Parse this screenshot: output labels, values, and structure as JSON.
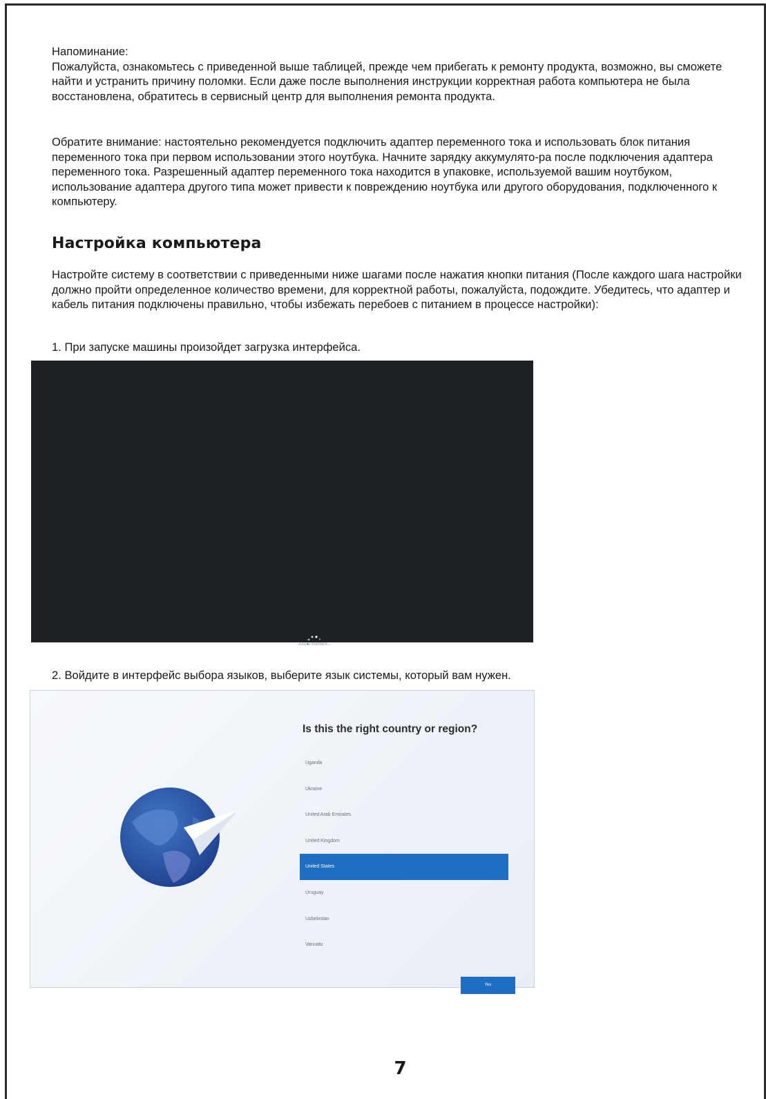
{
  "reminder": {
    "title": "Напоминание:",
    "body": "Пожалуйста, ознакомьтесь с  приведенной выше таблицей, прежде чем прибегать к ремонту продукта, возможно, вы сможете найти и устранить причину поломки. Если даже после  выполнения  инструкции корректная работа компьютера не была восстановлена,  обратитесь в сервисный центр для выполнения ремонта продукта."
  },
  "note": "Обратите внимание: настоятельно рекомендуется подключить адаптер переменного тока и использовать блок питания переменного тока при первом использовании этого ноутбука. Начните зарядку аккумулято-ра после подключения адаптера переменного тока. Разрешенный адаптер переменного тока находится в упаковке, используемой вашим ноутбуком, использование адаптера другого типа может привести к повреждению ноутбука или другого оборудования, подключенного к компьютеру.",
  "setup": {
    "heading": "Настройка компьютера",
    "intro": "Настройте систему в соответствии с приведенными ниже шагами после нажатия кнопки питания (После каждого шага настройки должно пройти определенное количество времени, для корректной работы, пожалуйста, подождите. Убедитесь, что адаптер и кабель питания подключены правильно, чтобы избежать перебоев с питанием в процессе настройки):",
    "step1": "1. При запуске машины произойдет загрузка интерфейса.",
    "step2": "2. Войдите в интерфейс выбора языков, выберите язык системы, который вам нужен."
  },
  "loading_screen": {
    "text": "Just a moment...",
    "icon": "spinner-icon"
  },
  "region_screen": {
    "title": "Is this the right country or region?",
    "regions": [
      {
        "label": "Uganda",
        "selected": false
      },
      {
        "label": "Ukraine",
        "selected": false
      },
      {
        "label": "United Arab Emirates",
        "selected": false
      },
      {
        "label": "United Kingdom",
        "selected": false
      },
      {
        "label": "United States",
        "selected": true
      },
      {
        "label": "Uruguay",
        "selected": false
      },
      {
        "label": "Uzbekistan",
        "selected": false
      },
      {
        "label": "Vanuatu",
        "selected": false
      }
    ],
    "next_label": "Yes",
    "accent": "#1e6fc4",
    "icon": "globe-icon"
  },
  "page_number": "7"
}
